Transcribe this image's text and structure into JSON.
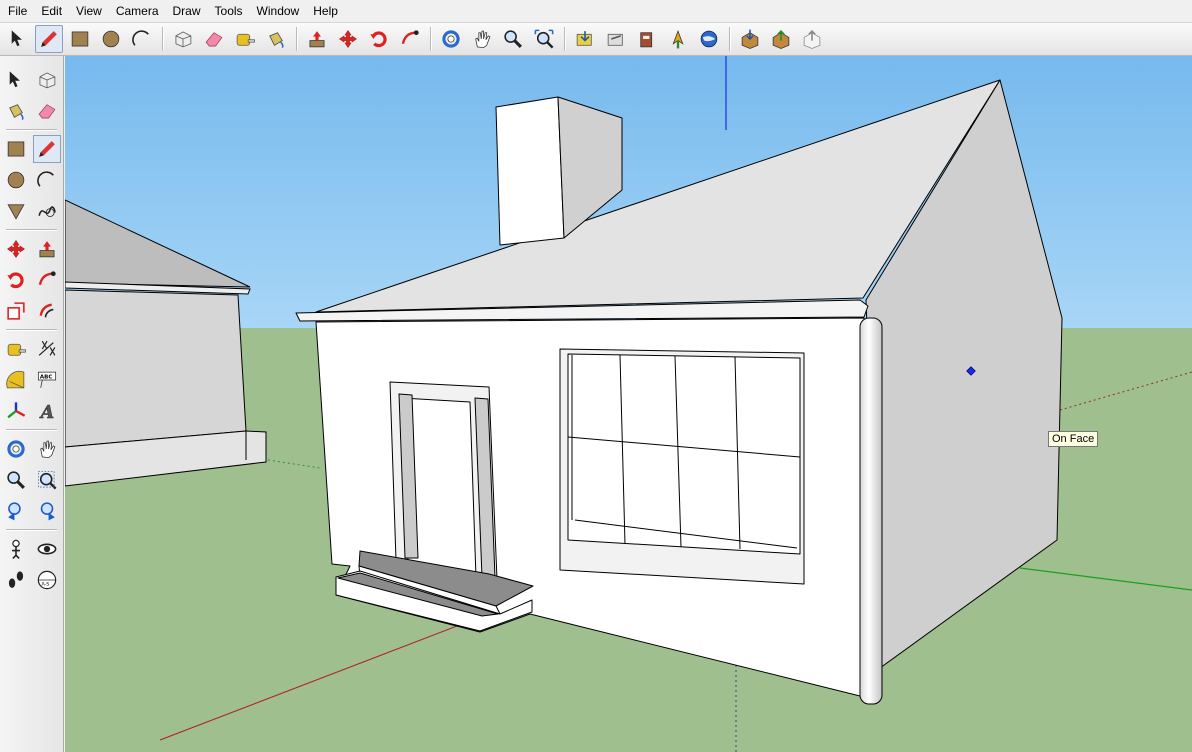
{
  "menubar": {
    "items": [
      {
        "label": "File"
      },
      {
        "label": "Edit"
      },
      {
        "label": "View"
      },
      {
        "label": "Camera"
      },
      {
        "label": "Draw"
      },
      {
        "label": "Tools"
      },
      {
        "label": "Window"
      },
      {
        "label": "Help"
      }
    ]
  },
  "toolbar": {
    "groups": [
      [
        "select-icon",
        "pencil-line-icon",
        "rectangle-icon",
        "circle-icon",
        "arc-icon"
      ],
      [
        "make-component-icon",
        "eraser-icon",
        "tape-measure-icon",
        "paint-bucket-icon"
      ],
      [
        "push-pull-icon",
        "move-icon",
        "rotate-icon",
        "follow-me-icon"
      ],
      [
        "orbit-icon",
        "pan-icon",
        "zoom-icon",
        "zoom-extents-icon"
      ],
      [
        "get-models-icon",
        "share-model-icon",
        "model-warehouse-icon",
        "add-location-icon",
        "google-earth-icon"
      ],
      [
        "get-models-warehouse-icon",
        "share-component-icon",
        "upload-icon"
      ]
    ],
    "active": "pencil-line-icon"
  },
  "sidebar": {
    "groups": [
      [
        [
          "select-icon",
          "make-component-icon"
        ],
        [
          "paint-bucket-icon",
          "eraser-icon"
        ]
      ],
      [
        [
          "rectangle-icon",
          "line-icon"
        ],
        [
          "circle-icon",
          "arc-icon"
        ],
        [
          "polygon-icon",
          "freehand-icon"
        ]
      ],
      [
        [
          "move-icon",
          "push-pull-icon"
        ],
        [
          "rotate-icon",
          "follow-me-icon"
        ],
        [
          "scale-icon",
          "offset-icon"
        ]
      ],
      [
        [
          "tape-measure-icon",
          "dimension-icon"
        ],
        [
          "protractor-icon",
          "text-icon"
        ],
        [
          "axes-icon",
          "3d-text-icon"
        ]
      ],
      [
        [
          "orbit-icon",
          "pan-icon"
        ],
        [
          "zoom-icon",
          "zoom-window-icon"
        ],
        [
          "previous-view-icon",
          "next-view-icon"
        ]
      ],
      [
        [
          "position-camera-icon",
          "look-around-icon"
        ],
        [
          "walk-icon",
          "section-plane-icon"
        ]
      ]
    ],
    "active": "line-icon",
    "labels": {
      "text_tool": "ABC",
      "section_plane": "A-S"
    }
  },
  "viewport": {
    "tooltip": "On Face",
    "colors": {
      "sky": "#86c3f0",
      "ground": "#9fbf8f",
      "face_front": "#ffffff",
      "face_side": "#cfcfcf",
      "roof": "#e2e2e2",
      "edge": "#000000",
      "inference_point": "#1c2ee0"
    }
  }
}
